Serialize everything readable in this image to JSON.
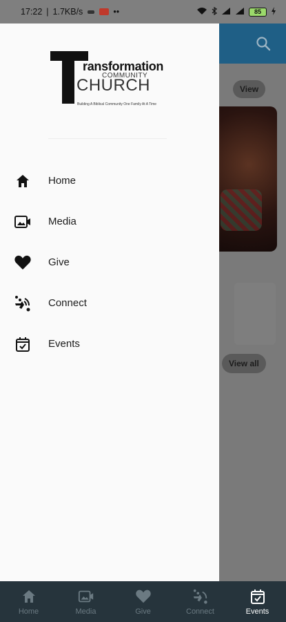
{
  "status_bar": {
    "time": "17:22",
    "speed": "1.7KB/s",
    "dots": "••",
    "battery": "85"
  },
  "background": {
    "view_label": "View",
    "view_all_label": "View all"
  },
  "drawer": {
    "logo": {
      "title": "ransformation",
      "community": "COMMUNITY",
      "church": "CHURCH",
      "tagline": "Building A Biblical Community One Family At A Time"
    },
    "menu": [
      {
        "label": "Home",
        "icon": "home-icon"
      },
      {
        "label": "Media",
        "icon": "video-icon"
      },
      {
        "label": "Give",
        "icon": "heart-icon"
      },
      {
        "label": "Connect",
        "icon": "connect-icon"
      },
      {
        "label": "Events",
        "icon": "calendar-icon"
      }
    ]
  },
  "bottom_nav": [
    {
      "label": "Home",
      "icon": "home-icon",
      "active": false
    },
    {
      "label": "Media",
      "icon": "video-icon",
      "active": false
    },
    {
      "label": "Give",
      "icon": "heart-icon",
      "active": false
    },
    {
      "label": "Connect",
      "icon": "connect-icon",
      "active": false
    },
    {
      "label": "Events",
      "icon": "calendar-icon",
      "active": true
    }
  ],
  "colors": {
    "app_bar": "#1f5f86",
    "drawer_bg": "#fafafa",
    "bottom_nav_bg": "#26343c",
    "nav_active": "#ffffff",
    "nav_inactive": "#6b7a82"
  }
}
